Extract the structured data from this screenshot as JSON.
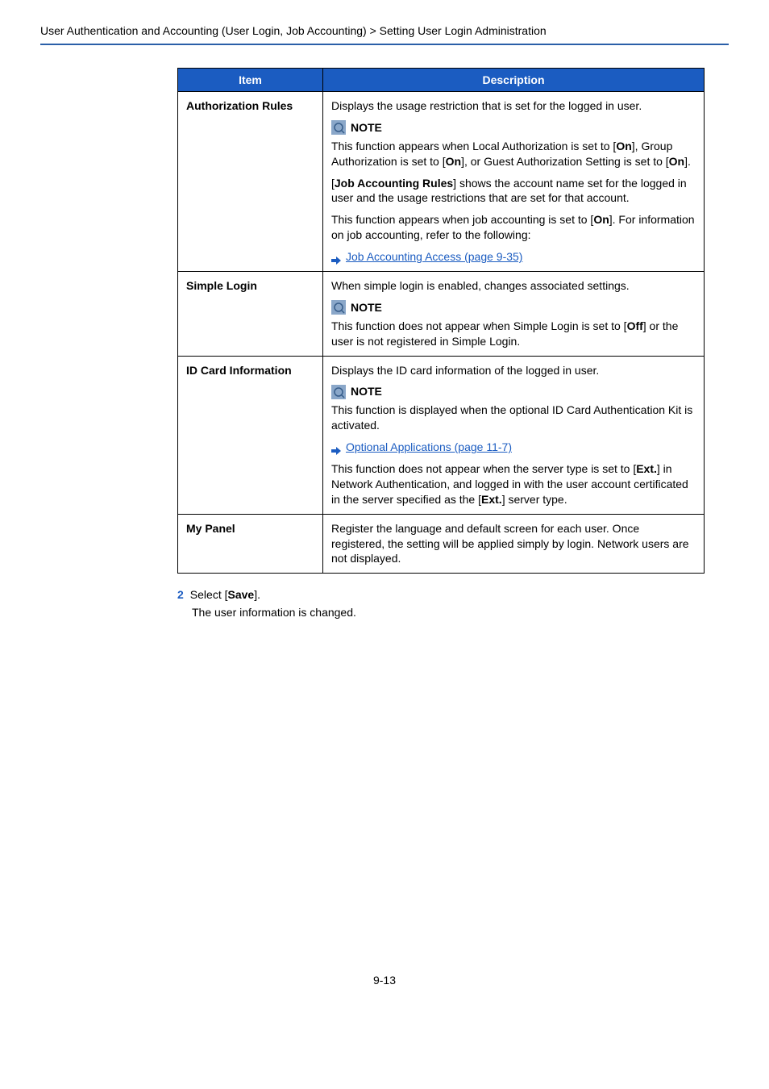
{
  "breadcrumb": "User Authentication and Accounting (User Login, Job Accounting) > Setting User Login Administration",
  "table": {
    "headers": {
      "item": "Item",
      "description": "Description"
    },
    "rows": [
      {
        "item": "Authorization Rules",
        "p1": "Displays the usage restriction that is set for the logged in user.",
        "note_label": "NOTE",
        "p2a": "This function appears when Local Authorization is set to [",
        "p2b": "On",
        "p2c": "], Group Authorization is set to [",
        "p2d": "On",
        "p2e": "], or Guest Authorization Setting is set to [",
        "p2f": "On",
        "p2g": "].",
        "p3a": "[",
        "p3b": "Job Accounting Rules",
        "p3c": "] shows the account name set for the logged in user and the usage restrictions that are set for that account.",
        "p4a": "This function appears when job accounting is set to [",
        "p4b": "On",
        "p4c": "]. For information on job accounting, refer to the following:",
        "link": "Job Accounting Access (page 9-35)"
      },
      {
        "item": "Simple Login",
        "p1": "When simple login is enabled, changes associated settings.",
        "note_label": "NOTE",
        "p2a": "This function does not appear when Simple Login is set to [",
        "p2b": "Off",
        "p2c": "] or the user is not registered in Simple Login."
      },
      {
        "item": "ID Card Information",
        "p1": "Displays the ID card information of the logged in user.",
        "note_label": "NOTE",
        "p2": "This function is displayed when the optional ID Card Authentication Kit is activated.",
        "link": "Optional Applications (page 11-7)",
        "p3a": "This function does not appear when the server type is set to [",
        "p3b": "Ext.",
        "p3c": "] in Network Authentication, and logged in with the user account certificated in the server specified as the [",
        "p3d": "Ext.",
        "p3e": "] server type."
      },
      {
        "item": "My Panel",
        "p1": "Register the language and default screen for each user. Once registered, the setting will be applied simply by login. Network users are not displayed."
      }
    ]
  },
  "step": {
    "num": "2",
    "text_a": "Select [",
    "text_b": "Save",
    "text_c": "]."
  },
  "followup": "The user information is changed.",
  "page_number": "9-13"
}
